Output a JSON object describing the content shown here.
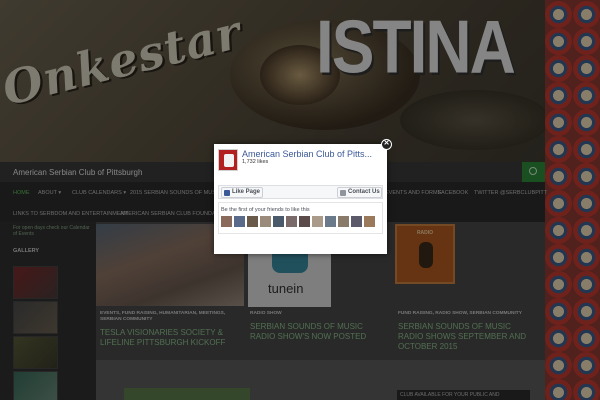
{
  "header": {
    "band_name_script": "Onkestar",
    "band_name_block": "ISTINA"
  },
  "site": {
    "title": "American Serbian Club of Pittsburgh"
  },
  "nav": {
    "items": [
      {
        "label": "HOME",
        "active": true
      },
      {
        "label": "ABOUT ▾"
      },
      {
        "label": "CLUB CALENDARS ▾"
      },
      {
        "label": "2015 SERBIAN SOUNDS OF MUSIC RADIO"
      },
      {
        "label": "EVENTS AND FORMS"
      },
      {
        "label": "FACEBOOK"
      },
      {
        "label": "TWITTER @SERBCLUBPITT"
      },
      {
        "label": "LINKS TO SERBDOM AND ENTERTAINMENT"
      },
      {
        "label": "AMERICAN SERBIAN CLUB FOUNDATION"
      }
    ]
  },
  "sidebar": {
    "intro": "For open days check our Calendar of Events",
    "gallery_heading": "GALLERY"
  },
  "posts": [
    {
      "categories": "EVENTS, FUND RAISING, HUMANITARIAN, MEETINGS, SERBIAN COMMUNITY",
      "title": "TESLA VISIONARIES SOCIETY & LIFELINE PITTSBURGH KICKOFF"
    },
    {
      "categories": "RADIO SHOW",
      "title": "SERBIAN SOUNDS OF MUSIC RADIO SHOW'S NOW POSTED"
    },
    {
      "categories": "FUND RAISING, RADIO SHOW, SERBIAN COMMUNITY",
      "title": "SERBIAN SOUNDS OF MUSIC RADIO SHOWS SEPTEMBER AND OCTOBER 2015"
    }
  ],
  "tunein_logo_text": "tunein",
  "radio_label": "RADIO",
  "right_widget_heading": "CLUB AVAILABLE FOR YOUR PUBLIC AND",
  "popup": {
    "page_name": "American Serbian Club of Pitts...",
    "likes": "1,732 likes",
    "like_button": "Like Page",
    "contact_button": "Contact Us",
    "friends_prompt": "Be the first of your friends to like this",
    "close_glyph": "✕"
  },
  "colors": {
    "accent_green": "#2e8b3a",
    "facebook_blue": "#3b5998",
    "nav_bg": "#2b2b2b"
  }
}
